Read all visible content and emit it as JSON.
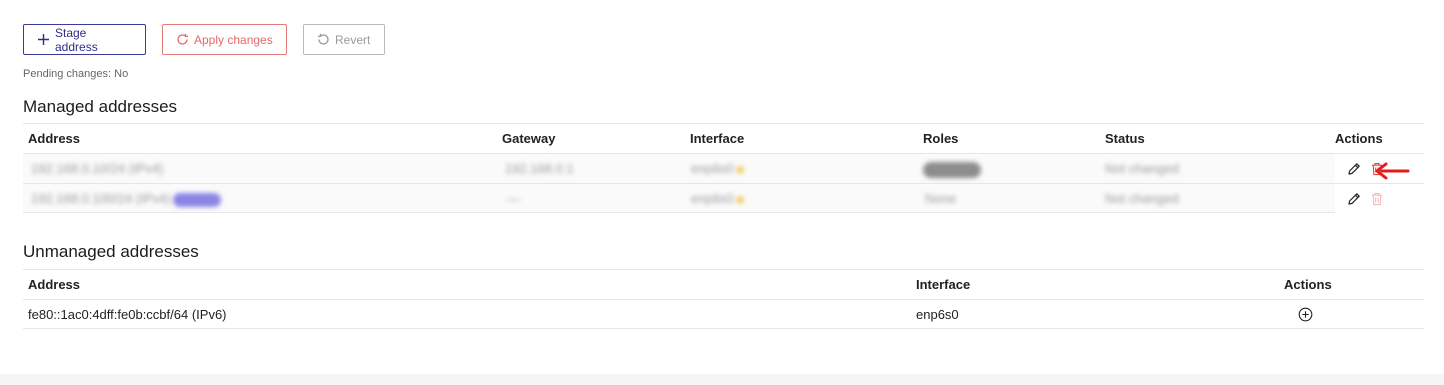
{
  "toolbar": {
    "stage_label": "Stage address",
    "apply_label": "Apply changes",
    "revert_label": "Revert"
  },
  "pending_changes": "Pending changes: No",
  "managed": {
    "title": "Managed addresses",
    "columns": {
      "address": "Address",
      "gateway": "Gateway",
      "interface": "Interface",
      "roles": "Roles",
      "status": "Status",
      "actions": "Actions"
    },
    "rows": [
      {
        "address": "192.168.0.10/24 (IPv4)",
        "gateway": "192.168.0.1",
        "interface": "enp6s0",
        "roles": "",
        "status": "Not changed"
      },
      {
        "address": "192.168.0.100/24 (IPv4)",
        "gateway": "—",
        "interface": "enp6s0",
        "roles": "None",
        "status": "Not changed"
      }
    ]
  },
  "unmanaged": {
    "title": "Unmanaged addresses",
    "columns": {
      "address": "Address",
      "interface": "Interface",
      "actions": "Actions"
    },
    "rows": [
      {
        "address": "fe80::1ac0:4dff:fe0b:ccbf/64 (IPv6)",
        "interface": "enp6s0"
      }
    ]
  },
  "colors": {
    "primary": "#2d2c8a",
    "danger": "#e26a6a",
    "delete_icon": "#d94848",
    "arrow": "#e41b1b",
    "muted": "#9a9a9a"
  },
  "icons": [
    "plus-icon",
    "refresh-icon",
    "undo-icon",
    "pencil-icon",
    "trash-icon",
    "add-circle-icon",
    "arrow-left-icon"
  ]
}
